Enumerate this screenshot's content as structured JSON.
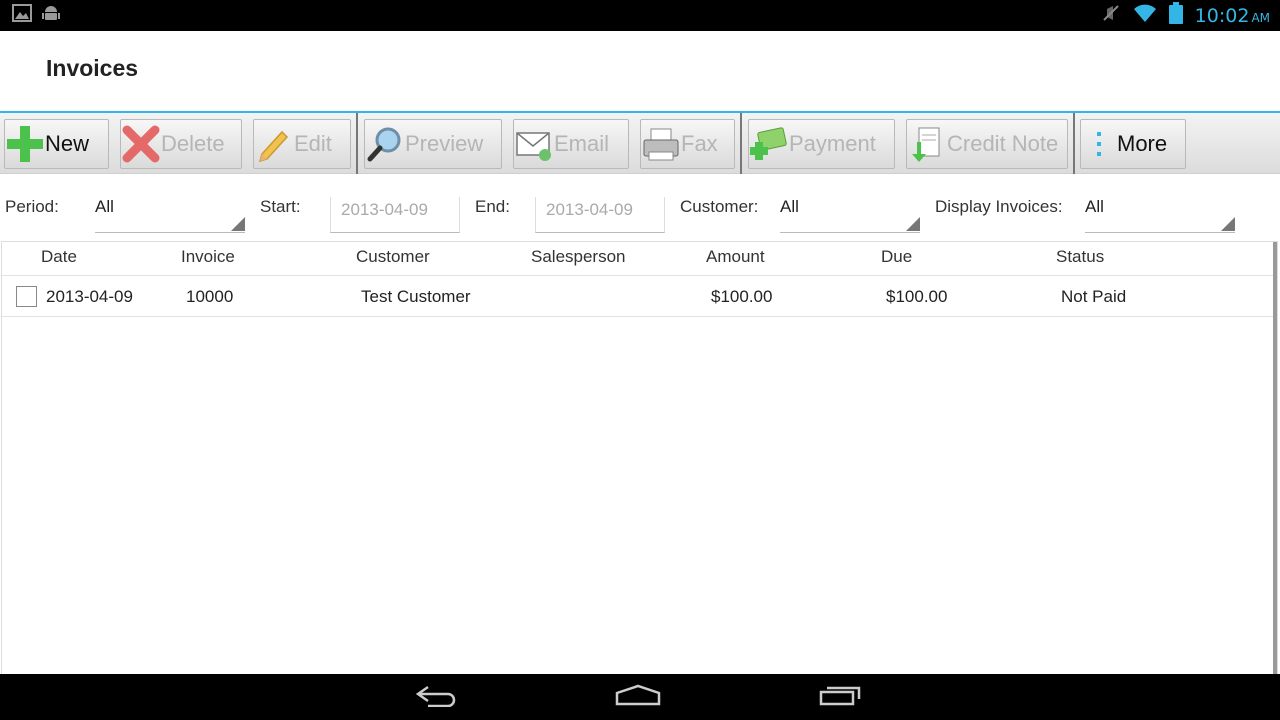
{
  "status_bar": {
    "time": "10:02",
    "ampm": "AM",
    "icons": [
      "gallery-icon",
      "android-icon",
      "mute-icon",
      "wifi-icon",
      "battery-icon"
    ]
  },
  "title": "Invoices",
  "colors": {
    "accent": "#33b5e5",
    "disabled_text": "#b5b5b5"
  },
  "toolbar": {
    "new_label": "New",
    "delete_label": "Delete",
    "edit_label": "Edit",
    "preview_label": "Preview",
    "email_label": "Email",
    "fax_label": "Fax",
    "payment_label": "Payment",
    "credit_note_label": "Credit Note",
    "more_label": "More"
  },
  "filters": {
    "period_label": "Period:",
    "period_value": "All",
    "start_label": "Start:",
    "start_value": "2013-04-09",
    "end_label": "End:",
    "end_value": "2013-04-09",
    "customer_label": "Customer:",
    "customer_value": "All",
    "display_label": "Display Invoices:",
    "display_value": "All"
  },
  "table": {
    "columns": [
      "Date",
      "Invoice",
      "Customer",
      "Salesperson",
      "Amount",
      "Due",
      "Status"
    ],
    "rows": [
      {
        "date": "2013-04-09",
        "invoice": "10000",
        "customer": "Test Customer",
        "salesperson": "",
        "amount": "$100.00",
        "due": "$100.00",
        "status": "Not Paid"
      }
    ]
  }
}
